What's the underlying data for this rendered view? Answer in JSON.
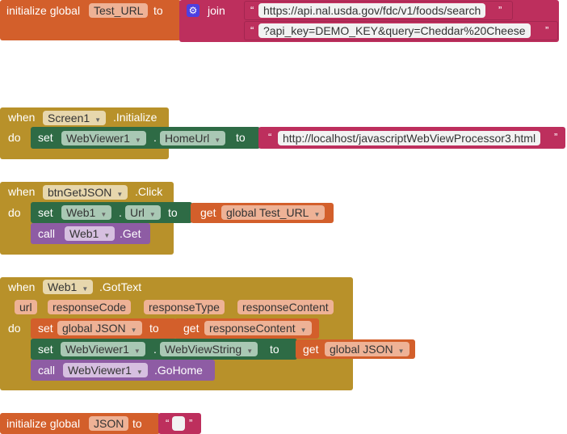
{
  "colors": {
    "variable": "#d35f2b",
    "text": "#bd2f5d",
    "event": "#b8912a",
    "setter": "#2e6b45",
    "method": "#8e5ca4"
  },
  "blocks": {
    "init_test_url": {
      "label": "initialize global",
      "name": "Test_URL",
      "to": "to",
      "join": "join",
      "gear_icon": "gear-icon",
      "open_quote": "“",
      "close_quote": "”",
      "text1": "https://api.nal.usda.gov/fdc/v1/foods/search",
      "text2": "?api_key=DEMO_KEY&query=Cheddar%20Cheese"
    },
    "screen_init": {
      "when": "when",
      "component": "Screen1",
      "event": ".Initialize",
      "do": "do",
      "set": "set",
      "target": "WebViewer1",
      "dot": ".",
      "prop": "HomeUrl",
      "to": "to",
      "value": "http://localhost/javascriptWebViewProcessor3.html"
    },
    "btn_click": {
      "when": "when",
      "component": "btnGetJSON",
      "event": ".Click",
      "do": "do",
      "set": "set",
      "target": "Web1",
      "dot": ".",
      "prop": "Url",
      "to": "to",
      "get": "get",
      "var": "global Test_URL",
      "call": "call",
      "call_target": "Web1",
      "method": ".Get"
    },
    "got_text": {
      "when": "when",
      "component": "Web1",
      "event": ".GotText",
      "params": [
        "url",
        "responseCode",
        "responseType",
        "responseContent"
      ],
      "do": "do",
      "set1": "set",
      "var1": "global JSON",
      "to1": "to",
      "get1": "get",
      "val1": "responseContent",
      "set2": "set",
      "target2": "WebViewer1",
      "dot": ".",
      "prop2": "WebViewString",
      "to2": "to",
      "get2": "get",
      "val2": "global JSON",
      "call": "call",
      "call_target": "WebViewer1",
      "method": ".GoHome"
    },
    "init_json": {
      "label": "initialize global",
      "name": "JSON",
      "to": "to",
      "open_quote": "“",
      "close_quote": "”"
    }
  }
}
